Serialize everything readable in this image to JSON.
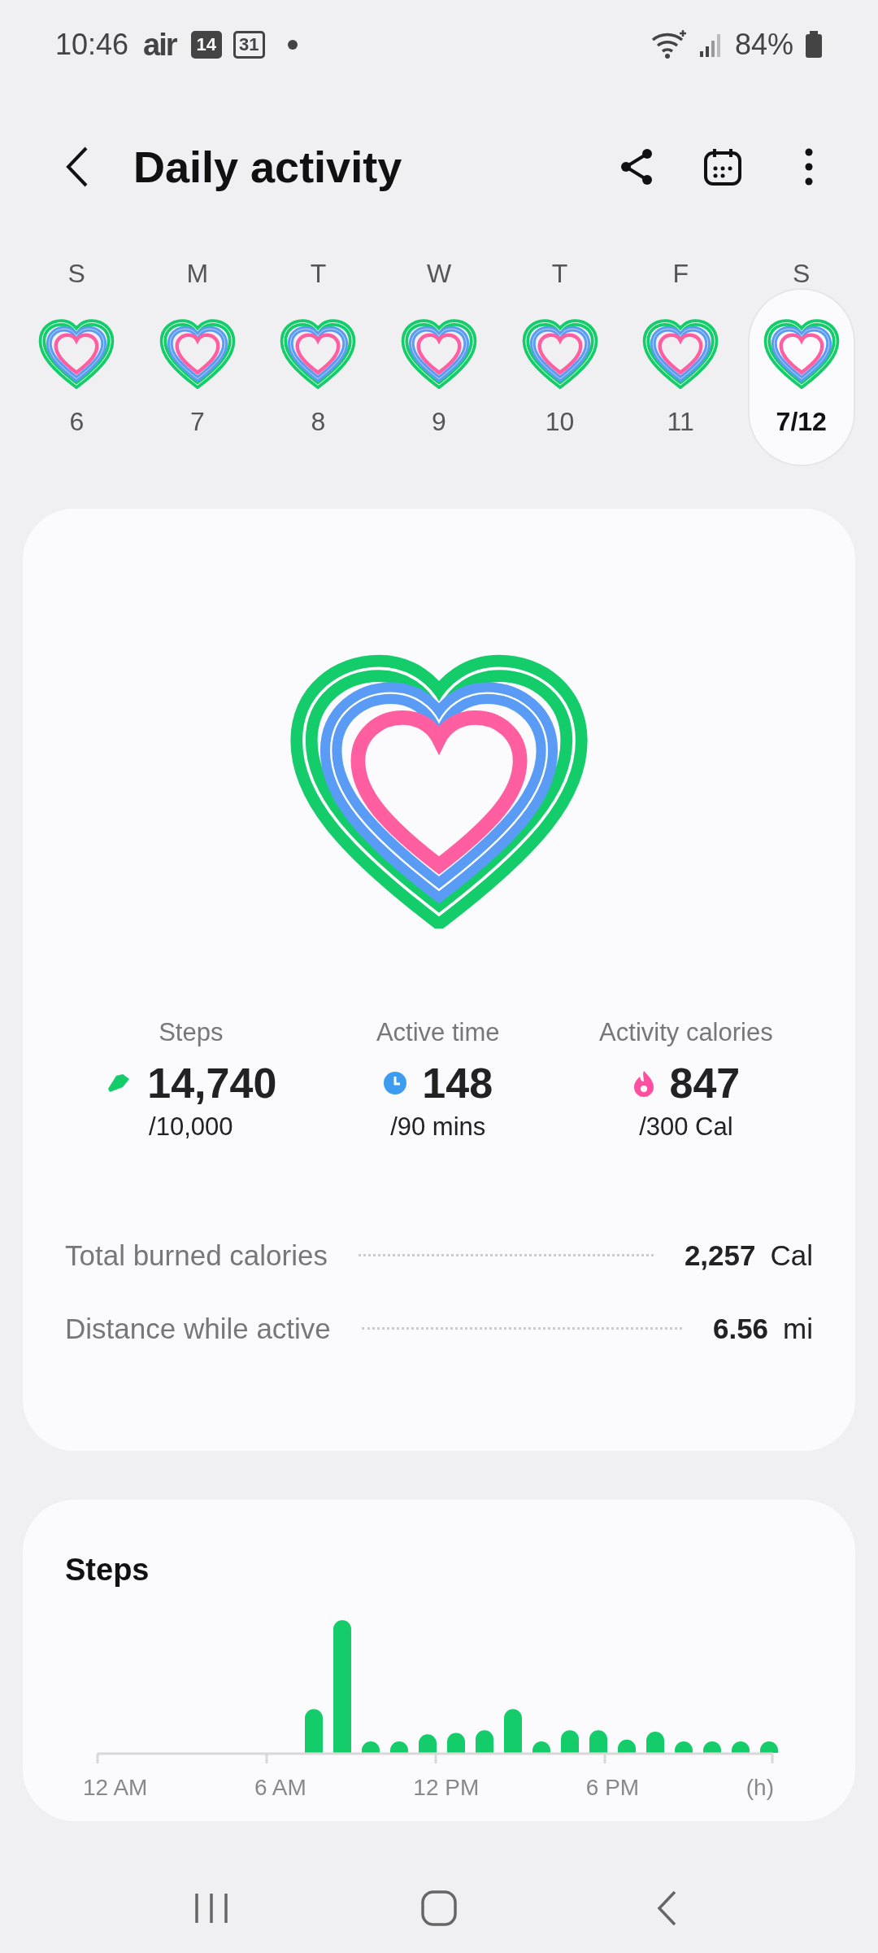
{
  "status_bar": {
    "time": "10:46",
    "notifications": [
      "air",
      "14",
      "31"
    ],
    "battery": "84%"
  },
  "header": {
    "title": "Daily activity"
  },
  "days": [
    {
      "weekday": "S",
      "date": "6",
      "selected": false
    },
    {
      "weekday": "M",
      "date": "7",
      "selected": false
    },
    {
      "weekday": "T",
      "date": "8",
      "selected": false
    },
    {
      "weekday": "W",
      "date": "9",
      "selected": false
    },
    {
      "weekday": "T",
      "date": "10",
      "selected": false
    },
    {
      "weekday": "F",
      "date": "11",
      "selected": false
    },
    {
      "weekday": "S",
      "date": "7/12",
      "selected": true
    }
  ],
  "summary": {
    "stats": [
      {
        "kind": "steps",
        "label": "Steps",
        "value": "14,740",
        "goal": "/10,000"
      },
      {
        "kind": "time",
        "label": "Active time",
        "value": "148",
        "goal": "/90 mins"
      },
      {
        "kind": "calories",
        "label": "Activity calories",
        "value": "847",
        "goal": "/300 Cal"
      }
    ],
    "rows": [
      {
        "label": "Total burned calories",
        "value": "2,257",
        "unit": "Cal"
      },
      {
        "label": "Distance while active",
        "value": "6.56",
        "unit": "mi"
      }
    ]
  },
  "steps_card": {
    "title": "Steps",
    "axis_labels": [
      "12 AM",
      "6 AM",
      "12 PM",
      "6 PM",
      "(h)"
    ]
  }
}
